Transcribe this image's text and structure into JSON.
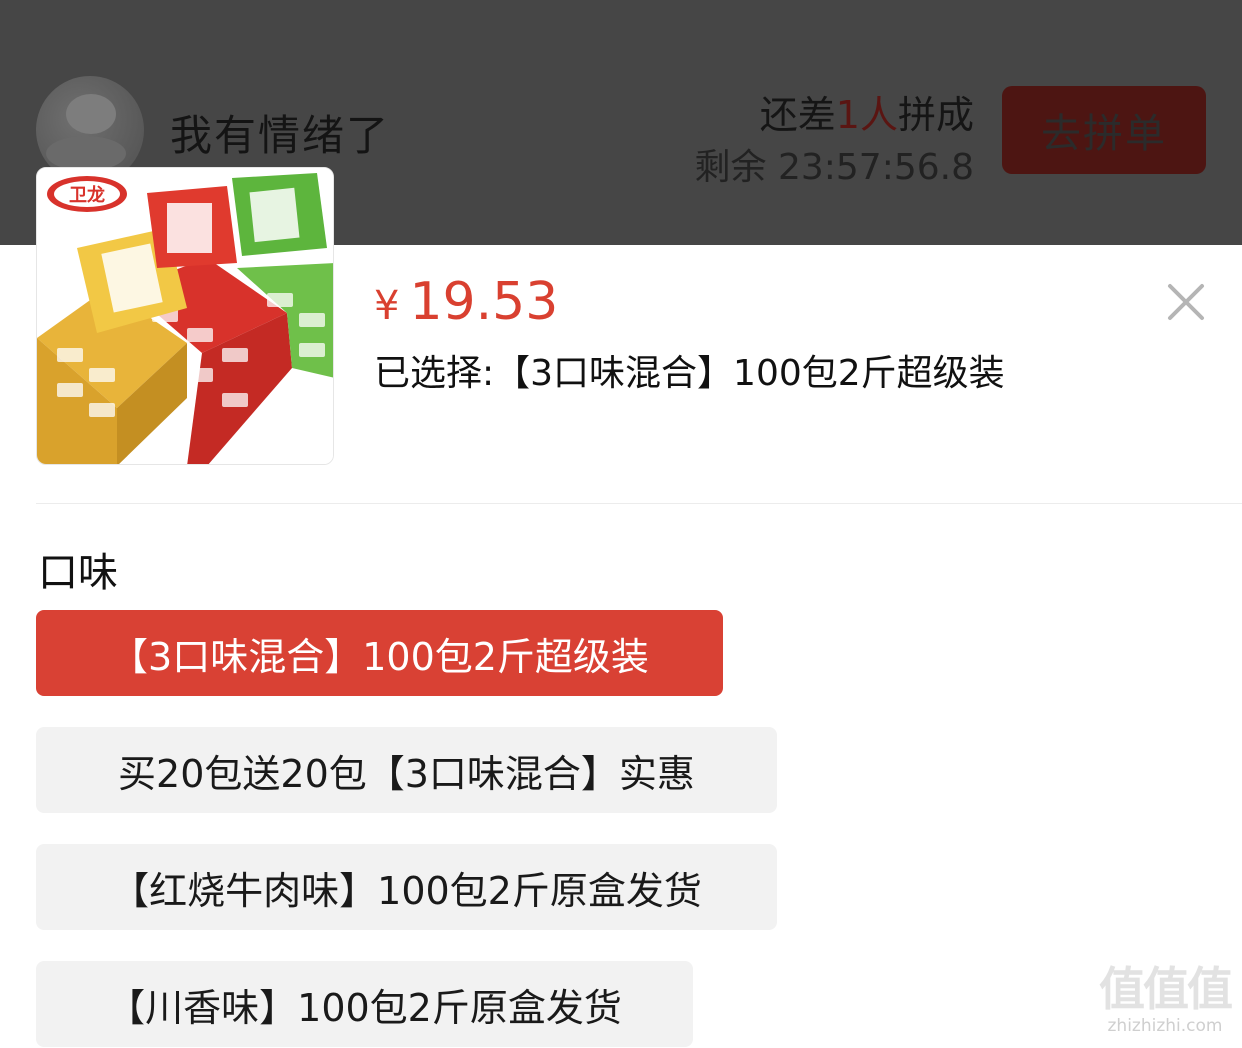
{
  "group_buy": {
    "user_name": "我有情绪了",
    "need_prefix": "还差",
    "need_count": "1人",
    "need_suffix": "拼成",
    "remaining_label": "剩余",
    "remaining_time": "23:57:56.8",
    "join_button": "去拼单"
  },
  "product": {
    "currency": "¥",
    "price": "19.53",
    "selected_label": "已选择:",
    "selected_value": "【3口味混合】100包2斤超级装",
    "image_brand": "卫龙"
  },
  "options": {
    "section_title": "口味",
    "items": [
      {
        "label": "【3口味混合】100包2斤超级装",
        "selected": true
      },
      {
        "label": "买20包送20包【3口味混合】实惠",
        "selected": false
      },
      {
        "label": "【红烧牛肉味】100包2斤原盒发货",
        "selected": false
      },
      {
        "label": "【川香味】100包2斤原盒发货",
        "selected": false
      }
    ]
  },
  "watermark": {
    "glyphs": "值值值",
    "domain": "zhizhizhi.com"
  },
  "colors": {
    "accent": "#d94134",
    "price": "#d94030",
    "overlay": "#464646",
    "option_bg": "#f2f2f2"
  },
  "icons": {
    "close": "close-icon"
  }
}
